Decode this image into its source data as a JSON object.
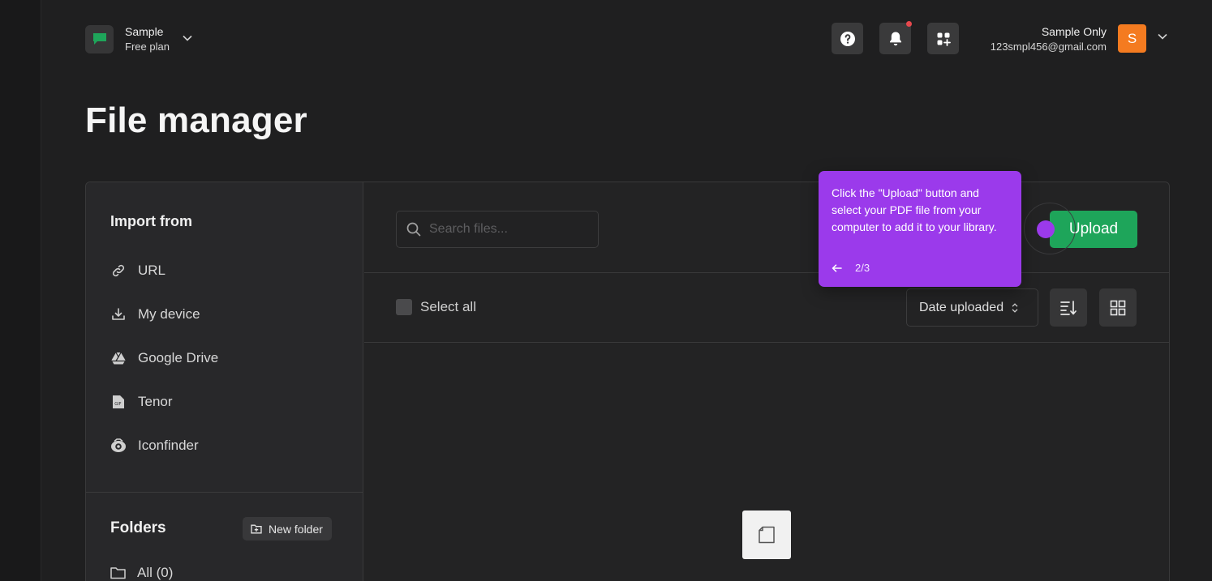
{
  "workspace": {
    "name": "Sample",
    "plan": "Free plan"
  },
  "user": {
    "name": "Sample Only",
    "email": "123smpl456@gmail.com",
    "initial": "S"
  },
  "page": {
    "title": "File manager"
  },
  "import": {
    "heading": "Import from",
    "items": [
      {
        "label": "URL",
        "icon": "link-icon"
      },
      {
        "label": "My device",
        "icon": "download-icon"
      },
      {
        "label": "Google Drive",
        "icon": "google-drive-icon"
      },
      {
        "label": "Tenor",
        "icon": "gif-icon"
      },
      {
        "label": "Iconfinder",
        "icon": "iconfinder-icon"
      }
    ]
  },
  "folders": {
    "heading": "Folders",
    "new_folder_label": "New folder",
    "all_label": "All (0)"
  },
  "toolbar": {
    "search_placeholder": "Search files...",
    "upload_label": "Upload",
    "select_all_label": "Select all",
    "sort_label": "Date uploaded"
  },
  "tooltip": {
    "text": "Click the \"Upload\" button and select your PDF file from your computer to add it to your library.",
    "step": "2/3"
  },
  "colors": {
    "accent_green": "#1ea55a",
    "tooltip_purple": "#9b3aeb",
    "avatar_orange": "#f47b20",
    "notification_red": "#e5484d"
  }
}
